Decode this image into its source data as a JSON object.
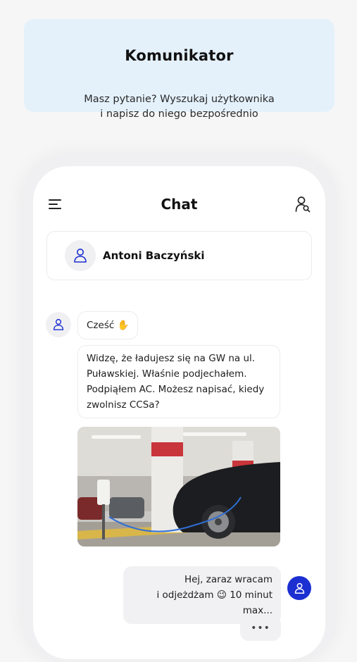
{
  "banner": {
    "title": "Komunikator",
    "subtitle_line1": "Masz pytanie? Wyszukaj użytkownika",
    "subtitle_line2": "i napisz do niego bezpośrednio",
    "background": "#e4f1fb"
  },
  "chat": {
    "title": "Chat",
    "menu_icon": "hamburger-menu-icon",
    "search_icon": "user-search-icon",
    "contact": {
      "name": "Antoni Baczyński",
      "avatar_icon": "user-icon"
    },
    "messages": [
      {
        "direction": "incoming",
        "text": "Cześć ✋"
      },
      {
        "direction": "incoming",
        "text": "Widzę, że ładujesz się na GW na ul. Puławskiej. Właśnie podjechałem. Podpiąłem AC. Możesz napisać, kiedy zwolnisz CCSa?"
      },
      {
        "direction": "incoming",
        "type": "image"
      },
      {
        "direction": "outgoing",
        "line1": "Hej, zaraz wracam",
        "line2": "i odjeżdżam 😉 10 minut max..."
      }
    ],
    "typing_indicator": "•••",
    "accent": "#1c2fd1"
  }
}
